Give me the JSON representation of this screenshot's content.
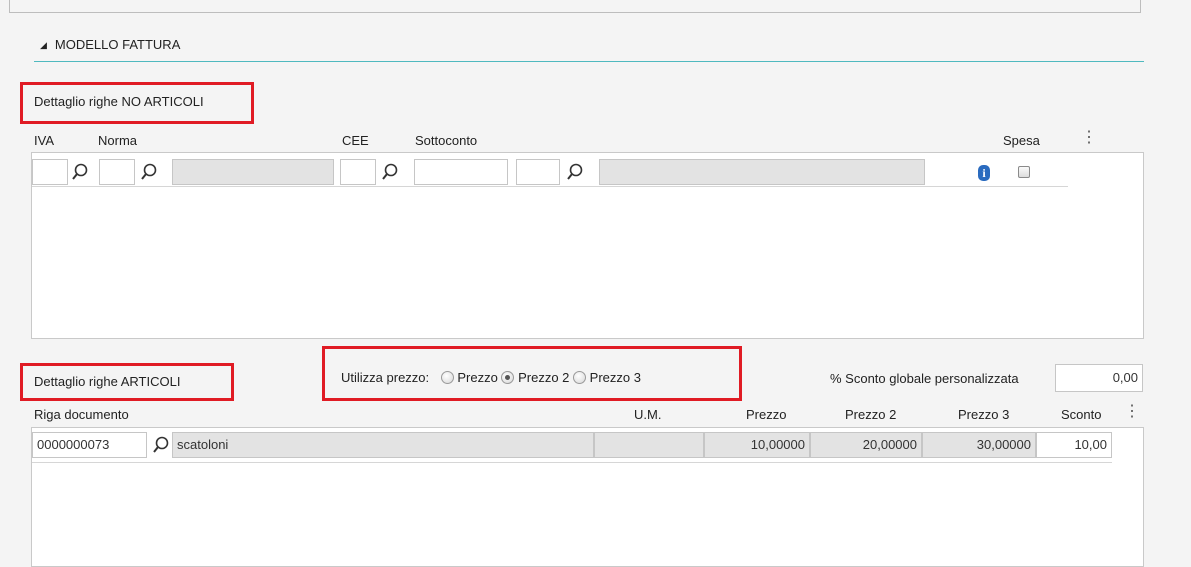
{
  "section": {
    "title": "MODELLO FATTURA",
    "collapse_glyph": "◢"
  },
  "no_articoli": {
    "title": "Dettaglio righe NO ARTICOLI",
    "columns": {
      "iva": "IVA",
      "norma": "Norma",
      "cee": "CEE",
      "sottoconto": "Sottoconto",
      "spesa": "Spesa"
    },
    "row": {
      "iva": "",
      "norma": "",
      "norma_desc": "",
      "cee": "",
      "sottoconto_a": "",
      "sottoconto_b": "",
      "sottoconto_desc": "",
      "spesa_checked": false
    }
  },
  "articoli": {
    "title": "Dettaglio righe ARTICOLI",
    "prezzo_label": "Utilizza prezzo:",
    "prezzo_options": [
      "Prezzo",
      "Prezzo 2",
      "Prezzo 3"
    ],
    "prezzo_selected": "Prezzo 2",
    "sconto_label": "% Sconto globale personalizzata",
    "sconto_value": "0,00",
    "columns": {
      "riga": "Riga documento",
      "um": "U.M.",
      "prezzo": "Prezzo",
      "prezzo2": "Prezzo 2",
      "prezzo3": "Prezzo 3",
      "sconto": "Sconto"
    },
    "row": {
      "code": "0000000073",
      "desc": "scatoloni",
      "um": "",
      "prezzo": "10,00000",
      "prezzo2": "20,00000",
      "prezzo3": "30,00000",
      "sconto": "10,00"
    }
  },
  "icons": {
    "lookup": "magnifier-icon",
    "info": "info-icon",
    "menu": "kebab-menu-icon"
  },
  "colors": {
    "highlight": "#e01b24",
    "accent_line": "#4fb9bf",
    "info": "#2a6bbf"
  }
}
